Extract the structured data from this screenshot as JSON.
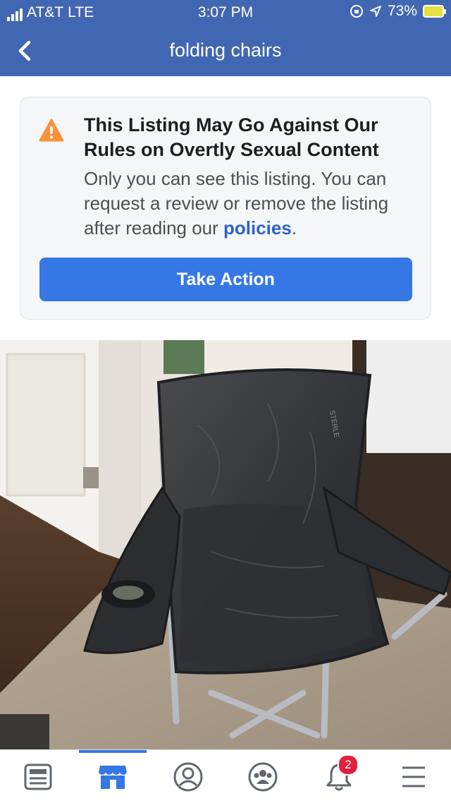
{
  "status_bar": {
    "carrier": "AT&T",
    "network": "LTE",
    "time": "3:07 PM",
    "battery": "73%"
  },
  "nav": {
    "title": "folding chairs",
    "back_icon": "chevron-left-icon"
  },
  "warning": {
    "icon": "warning-triangle-icon",
    "title": "This Listing May Go Against Our Rules on Overtly Sexual Content",
    "body": "Only you can see this listing. You can request a review or remove the listing after reading our ",
    "link_text": "policies",
    "body_end": ".",
    "button_label": "Take Action"
  },
  "photo": {
    "chair_tag_text": "STERLE"
  },
  "tab_bar": {
    "tabs": [
      {
        "icon": "news-feed-icon",
        "active": false
      },
      {
        "icon": "marketplace-icon",
        "active": true
      },
      {
        "icon": "profile-icon",
        "active": false
      },
      {
        "icon": "groups-icon",
        "active": false
      },
      {
        "icon": "notifications-bell-icon",
        "active": false,
        "badge": "2"
      },
      {
        "icon": "menu-icon",
        "active": false
      }
    ]
  },
  "colors": {
    "header_blue": "#4267b2",
    "button_blue": "#3578e5",
    "link_blue": "#2e63c8",
    "warning_orange": "#f7923a",
    "badge_red": "#e41e3f"
  }
}
